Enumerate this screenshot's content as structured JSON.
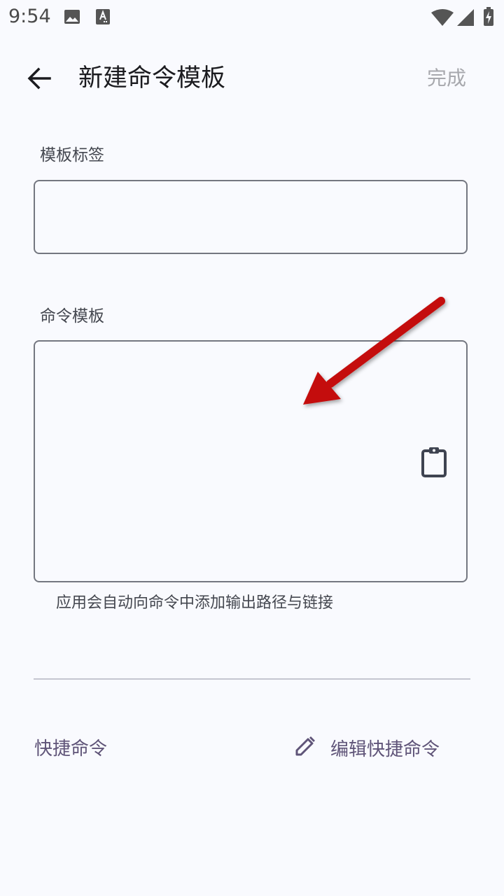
{
  "status_bar": {
    "time": "9:54",
    "icons": [
      "image-icon",
      "font-icon",
      "wifi-icon",
      "signal-icon",
      "battery-charging-icon"
    ]
  },
  "app_bar": {
    "title": "新建命令模板",
    "done_label": "完成"
  },
  "form": {
    "tag_label": "模板标签",
    "tag_value": "",
    "template_label": "命令模板",
    "template_value": "",
    "helper_text": "应用会自动向命令中添加输出路径与链接"
  },
  "shortcut": {
    "label": "快捷命令",
    "edit_label": "编辑快捷命令"
  },
  "colors": {
    "background": "#f9fafe",
    "outline": "#747780",
    "accent": "#5f5478",
    "disabled_text": "#a7a8ad",
    "annotation_arrow": "#c40d0d"
  }
}
